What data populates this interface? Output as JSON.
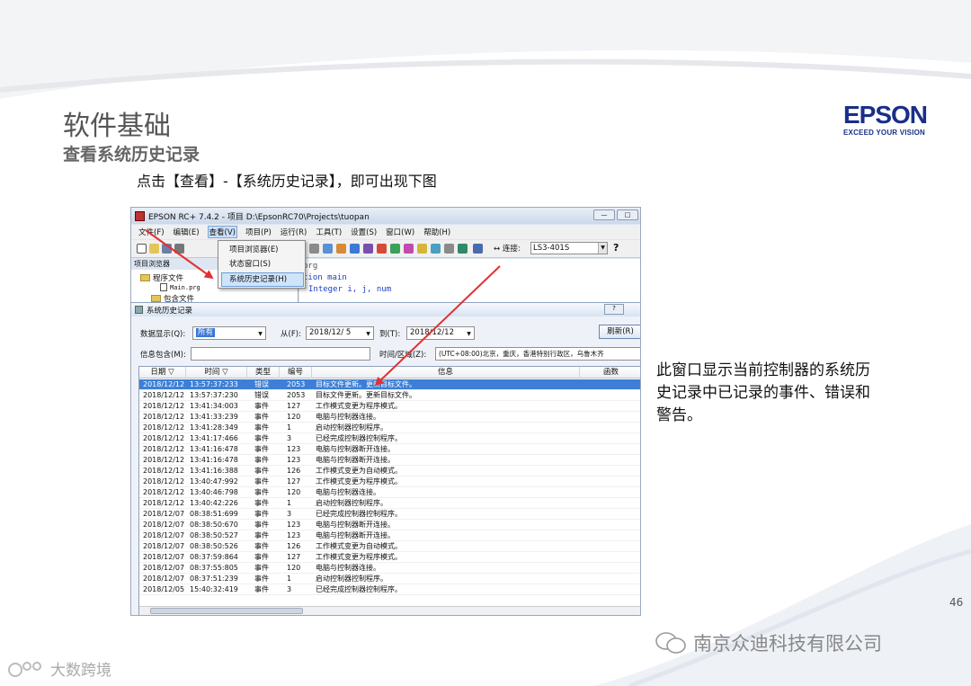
{
  "slide": {
    "title": "软件基础",
    "subtitle": "查看系统历史记录",
    "instruction": "点击【查看】-【系统历史记录】，即可出现下图",
    "callout": "此窗口显示当前控制器的系统历史记录中已记录的事件、错误和警告。",
    "page_number": "46",
    "watermark": "南京众迪科技有限公司",
    "brand": "大数跨境"
  },
  "logo": {
    "name": "EPSON",
    "tagline": "EXCEED YOUR VISION",
    "color": "#1a2f8a"
  },
  "app": {
    "title": "EPSON RC+ 7.4.2 - 项目 D:\\EpsonRC70\\Projects\\tuopan",
    "menu": [
      "文件(F)",
      "编辑(E)",
      "查看(V)",
      "项目(P)",
      "运行(R)",
      "工具(T)",
      "设置(S)",
      "窗口(W)",
      "帮助(H)"
    ],
    "connection_label": "↔ 连接:",
    "connection_value": "LS3-401S",
    "view_menu": [
      "项目浏览器(E)",
      "状态窗口(S)",
      "系统历史记录(H)"
    ],
    "project_panel": {
      "header": "项目浏览器",
      "items": [
        "程序文件",
        "Main.prg",
        "包含文件"
      ]
    },
    "code_lines": [
      "prg",
      "tion main",
      "Integer i, j, num"
    ]
  },
  "history": {
    "title": "系统历史记录",
    "display_label": "数据显示(Q):",
    "display_value": "所有",
    "from_label": "从(F):",
    "from_value": "2018/12/ 5",
    "to_label": "到(T):",
    "to_value": "2018/12/12",
    "refresh_label": "刷新(R)",
    "info_label": "信息包含(M):",
    "timezone_label": "时间/区域(Z):",
    "timezone_value": "(UTC+08:00)北京，重庆，香港特别行政区，乌鲁木齐",
    "columns": [
      "日期",
      "时间",
      "类型",
      "编号",
      "信息",
      "函数"
    ],
    "rows": [
      [
        "2018/12/12",
        "13:57:37:233",
        "错误",
        "2053",
        "目标文件更新。更新目标文件。"
      ],
      [
        "2018/12/12",
        "13:57:37:230",
        "错误",
        "2053",
        "目标文件更新。更新目标文件。"
      ],
      [
        "2018/12/12",
        "13:41:34:003",
        "事件",
        "127",
        "工作模式变更为程序模式。"
      ],
      [
        "2018/12/12",
        "13:41:33:239",
        "事件",
        "120",
        "电脑与控制器连接。"
      ],
      [
        "2018/12/12",
        "13:41:28:349",
        "事件",
        "1",
        "启动控制器控制程序。"
      ],
      [
        "2018/12/12",
        "13:41:17:466",
        "事件",
        "3",
        "已经完成控制器控制程序。"
      ],
      [
        "2018/12/12",
        "13:41:16:478",
        "事件",
        "123",
        "电脑与控制器断开连接。"
      ],
      [
        "2018/12/12",
        "13:41:16:478",
        "事件",
        "123",
        "电脑与控制器断开连接。"
      ],
      [
        "2018/12/12",
        "13:41:16:388",
        "事件",
        "126",
        "工作模式变更为自动模式。"
      ],
      [
        "2018/12/12",
        "13:40:47:992",
        "事件",
        "127",
        "工作模式变更为程序模式。"
      ],
      [
        "2018/12/12",
        "13:40:46:798",
        "事件",
        "120",
        "电脑与控制器连接。"
      ],
      [
        "2018/12/12",
        "13:40:42:226",
        "事件",
        "1",
        "启动控制器控制程序。"
      ],
      [
        "2018/12/07",
        "08:38:51:699",
        "事件",
        "3",
        "已经完成控制器控制程序。"
      ],
      [
        "2018/12/07",
        "08:38:50:670",
        "事件",
        "123",
        "电脑与控制器断开连接。"
      ],
      [
        "2018/12/07",
        "08:38:50:527",
        "事件",
        "123",
        "电脑与控制器断开连接。"
      ],
      [
        "2018/12/07",
        "08:38:50:526",
        "事件",
        "126",
        "工作模式变更为自动模式。"
      ],
      [
        "2018/12/07",
        "08:37:59:864",
        "事件",
        "127",
        "工作模式变更为程序模式。"
      ],
      [
        "2018/12/07",
        "08:37:55:805",
        "事件",
        "120",
        "电脑与控制器连接。"
      ],
      [
        "2018/12/07",
        "08:37:51:239",
        "事件",
        "1",
        "启动控制器控制程序。"
      ],
      [
        "2018/12/05",
        "15:40:32:419",
        "事件",
        "3",
        "已经完成控制器控制程序。"
      ]
    ]
  },
  "colors": {
    "selection": "#3d7fd6",
    "arrow": "#e33030"
  }
}
